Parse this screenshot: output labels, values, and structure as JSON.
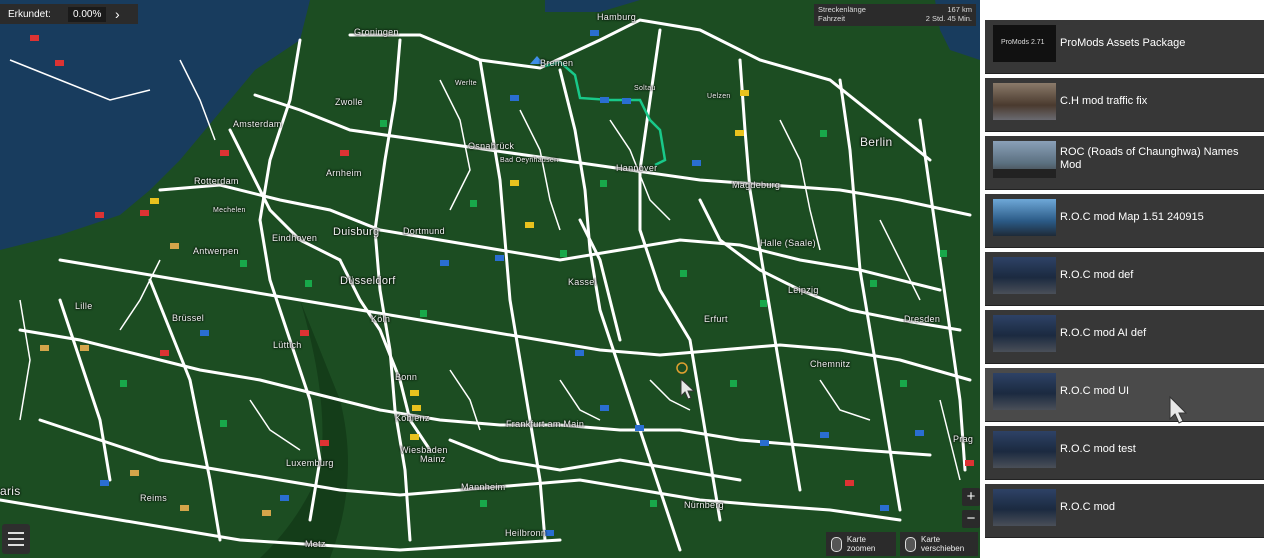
{
  "topbar": {
    "explored_label": "Erkundet:",
    "explored_value": "0.00%",
    "next_icon": "chevron-right-icon"
  },
  "route_info": {
    "distance_label": "Streckenlänge",
    "distance_value": "167 km",
    "time_label": "Fahrzeit",
    "time_value": "2 Std. 45 Min."
  },
  "map": {
    "cities": {
      "hamburg": "Hamburg",
      "groningen": "Groningen",
      "bremen": "Bremen",
      "werlte": "Werlte",
      "soltau": "Soltau",
      "uelzen": "Uelzen",
      "amsterdam": "Amsterdam",
      "zwolle": "Zwolle",
      "osnabrueck": "Osnabrück",
      "bad_oeynhausen": "Bad Oeynhausen",
      "berlin": "Berlin",
      "rotterdam": "Rotterdam",
      "arnheim": "Arnheim",
      "hannover": "Hannover",
      "magdeburg": "Magdeburg",
      "mechelen": "Mechelen",
      "eindhoven": "Eindhoven",
      "duisburg": "Duisburg",
      "dortmund": "Dortmund",
      "halle": "Halle (Saale)",
      "antwerpen": "Antwerpen",
      "kassel": "Kassel",
      "leipzig": "Leipzig",
      "duesseldorf": "Düsseldorf",
      "lille": "Lille",
      "bruessel": "Brüssel",
      "koeln": "Köln",
      "erfurt": "Erfurt",
      "dresden": "Dresden",
      "luettich": "Lüttich",
      "chemnitz": "Chemnitz",
      "bonn": "Bonn",
      "koblenz": "Koblenz",
      "frankfurt": "Frankfurt am Main",
      "prag": "Prag",
      "wiesbaden": "Wiesbaden",
      "mainz": "Mainz",
      "luxemburg": "Luxemburg",
      "paris": "aris",
      "reims": "Reims",
      "mannheim": "Mannheim",
      "nuernberg": "Nürnberg",
      "heilbronn": "Heilbronn",
      "metz": "Metz"
    },
    "zoom_in": "+",
    "zoom_out": "−",
    "hint_zoom": "Karte zoomen",
    "hint_move_1": "Karte",
    "hint_move_2": "verschieben"
  },
  "mods": [
    {
      "name": "ProMods Assets Package",
      "thumb": "promods-logo"
    },
    {
      "name": "C.H mod traffic fix",
      "thumb": "street-photo"
    },
    {
      "name": "ROC (Roads of Chaunghwa) Names Mod",
      "thumb": "english-names-banner"
    },
    {
      "name": "R.O.C mod Map 1.51 240915",
      "thumb": "city-skyline"
    },
    {
      "name": "R.O.C mod def",
      "thumb": "roc-logo"
    },
    {
      "name": "R.O.C mod AI def",
      "thumb": "roc-logo"
    },
    {
      "name": "R.O.C mod UI",
      "thumb": "roc-logo"
    },
    {
      "name": "R.O.C mod test",
      "thumb": "roc-logo"
    },
    {
      "name": "R.O.C mod",
      "thumb": "roc-logo"
    }
  ],
  "colors": {
    "land": "#1c4d22",
    "water": "#183c5e",
    "road": "#ffffff",
    "route": "#19c98a",
    "panel_item": "#373737"
  }
}
